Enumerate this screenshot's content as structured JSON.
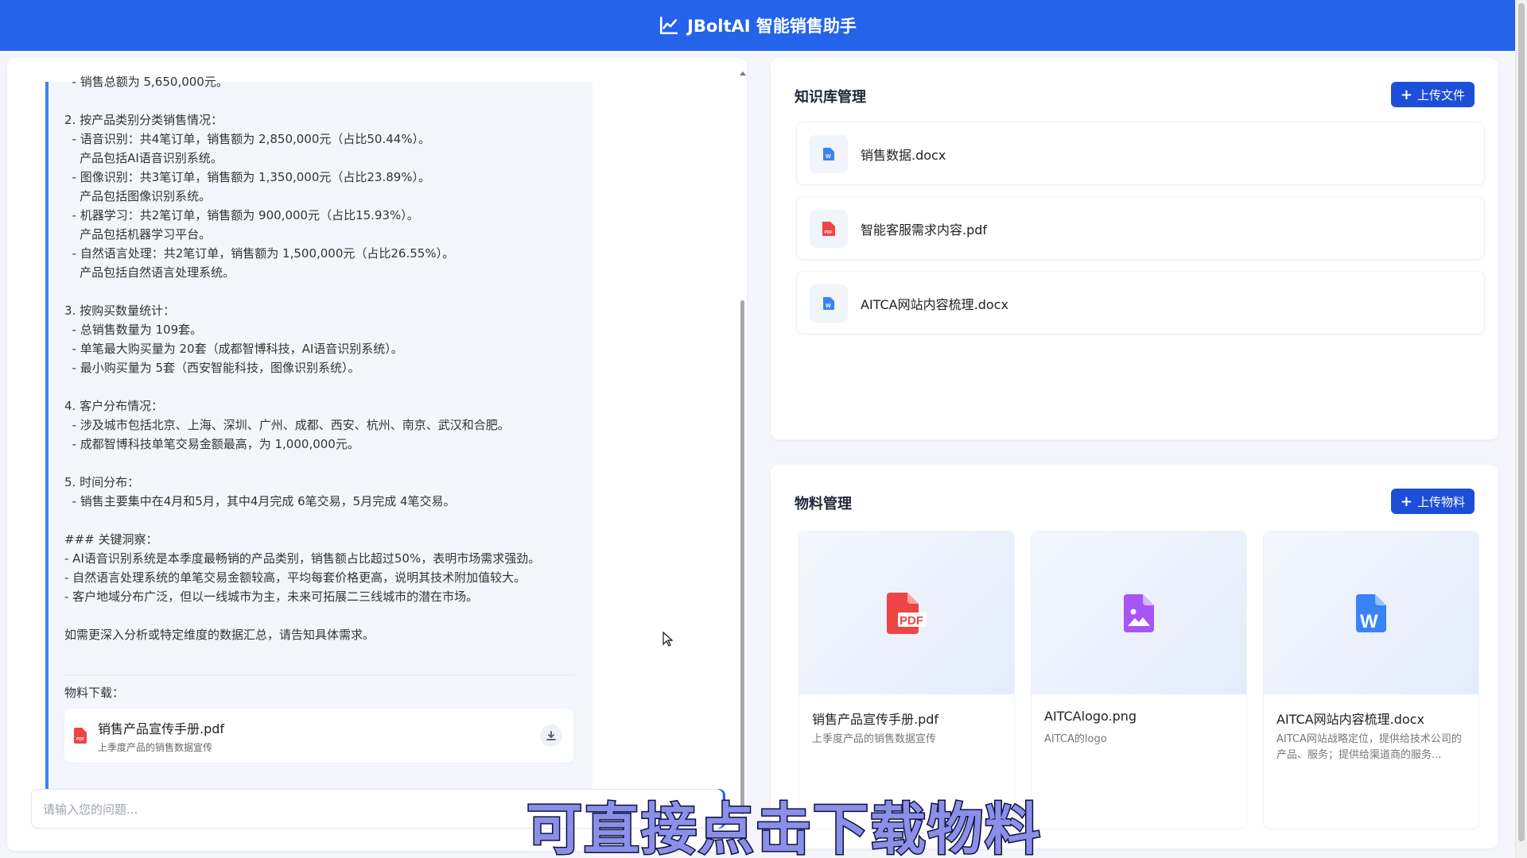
{
  "header": {
    "title": "JBoltAI 智能销售助手",
    "icon": "line-chart-icon",
    "bg_color": "#2563eb"
  },
  "chat": {
    "message": "  - 销售总额为 5,650,000元。\n\n2. 按产品类别分类销售情况：\n  - 语音识别：共4笔订单，销售额为 2,850,000元（占比50.44%）。\n    产品包括AI语音识别系统。\n  - 图像识别：共3笔订单，销售额为 1,350,000元（占比23.89%）。\n    产品包括图像识别系统。\n  - 机器学习：共2笔订单，销售额为 900,000元（占比15.93%）。\n    产品包括机器学习平台。\n  - 自然语言处理：共2笔订单，销售额为 1,500,000元（占比26.55%）。\n    产品包括自然语言处理系统。\n\n3. 按购买数量统计：\n  - 总销售数量为 109套。\n  - 单笔最大购买量为 20套（成都智博科技，AI语音识别系统）。\n  - 最小购买量为 5套（西安智能科技，图像识别系统）。\n\n4. 客户分布情况：\n  - 涉及城市包括北京、上海、深圳、广州、成都、西安、杭州、南京、武汉和合肥。\n  - 成都智博科技单笔交易金额最高，为 1,000,000元。\n\n5. 时间分布：\n  - 销售主要集中在4月和5月，其中4月完成 6笔交易，5月完成 4笔交易。\n\n### 关键洞察：\n- AI语音识别系统是本季度最畅销的产品类别，销售额占比超过50%，表明市场需求强劲。\n- 自然语言处理系统的单笔交易金额较高，平均每套价格更高，说明其技术附加值较大。\n- 客户地域分布广泛，但以一线城市为主，未来可拓展二三线城市的潜在市场。\n\n如需更深入分析或特定维度的数据汇总，请告知具体需求。",
    "download_label": "物料下载：",
    "download_file": {
      "name": "销售产品宣传手册.pdf",
      "desc": "上季度产品的销售数据宣传",
      "icon": "pdf-icon",
      "action_icon": "download-icon"
    },
    "input_placeholder": "请输入您的问题..."
  },
  "knowledge_base": {
    "title": "知识库管理",
    "upload_label": "上传文件",
    "items": [
      {
        "name": "销售数据.docx",
        "icon": "word-icon"
      },
      {
        "name": "智能客服需求内容.pdf",
        "icon": "pdf-icon"
      },
      {
        "name": "AITCA网站内容梳理.docx",
        "icon": "word-icon"
      }
    ]
  },
  "materials": {
    "title": "物料管理",
    "upload_label": "上传物料",
    "items": [
      {
        "name": "销售产品宣传手册.pdf",
        "desc": "上季度产品的销售数据宣传",
        "icon": "pdf-icon"
      },
      {
        "name": "AITCAlogo.png",
        "desc": "AITCA的logo",
        "icon": "image-icon"
      },
      {
        "name": "AITCA网站内容梳理.docx",
        "desc": "AITCA网站战略定位，提供给技术公司的产品、服务；提供给渠道商的服务...",
        "icon": "word-icon"
      }
    ]
  },
  "video_subtitle": "可直接点击下载物料",
  "colors": {
    "primary": "#2563eb",
    "pdf_red": "#ef4444",
    "word_blue": "#3b82f6",
    "image_purple": "#a855f7"
  }
}
